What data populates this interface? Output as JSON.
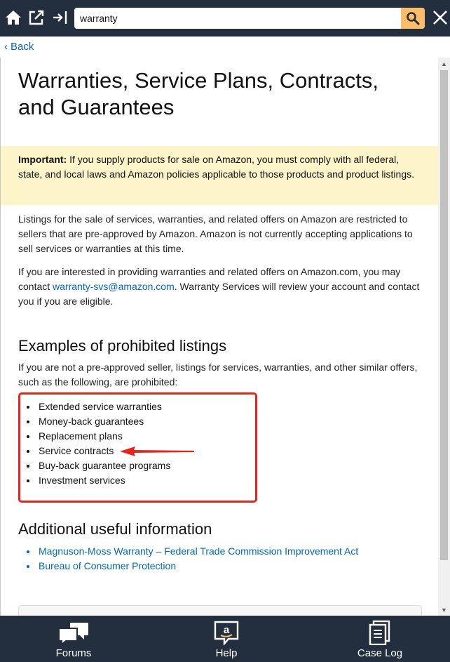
{
  "toolbar": {
    "search_value": "warranty",
    "icons": [
      "home-icon",
      "open-external-icon",
      "collapse-panel-icon",
      "search-icon",
      "close-icon"
    ]
  },
  "nav": {
    "back_label": "Back"
  },
  "article": {
    "title": "Warranties, Service Plans, Contracts, and Guarantees",
    "important_label": "Important:",
    "important_text": " If you supply products for sale on Amazon, you must comply with all federal, state, and local laws and Amazon policies applicable to those products and product listings.",
    "para1": "Listings for the sale of services, warranties, and related offers on Amazon are restricted to sellers that are pre-approved by Amazon. Amazon is not currently accepting applications to sell services or warranties at this time.",
    "para2_before": "If you are interested in providing warranties and related offers on Amazon.com, you may contact ",
    "para2_link": "warranty-svs@amazon.com",
    "para2_after": ". Warranty Services will review your account and contact you if you are eligible.",
    "prohibited_heading": "Examples of prohibited listings",
    "prohibited_intro": "If you are not a pre-approved seller, listings for services, warranties, and other similar offers, such as the following, are prohibited:",
    "prohibited_items": [
      "Extended service warranties",
      "Money-back guarantees",
      "Replacement plans",
      "Service contracts",
      "Buy-back guarantee programs",
      "Investment services"
    ],
    "additional_heading": "Additional useful information",
    "links": [
      "Magnuson-Moss Warranty – Federal Trade Commission Improvement Act",
      "Bureau of Consumer Protection"
    ]
  },
  "bottom_nav": {
    "items": [
      {
        "label": "Forums",
        "icon": "forums-icon"
      },
      {
        "label": "Help",
        "icon": "help-icon"
      },
      {
        "label": "Case Log",
        "icon": "case-log-icon"
      }
    ]
  },
  "colors": {
    "toolbar_bg": "#232f3e",
    "search_button": "#febd69",
    "link": "#0066c0",
    "important_bg": "#fdf4c9",
    "annotation_red": "#e8231c"
  }
}
